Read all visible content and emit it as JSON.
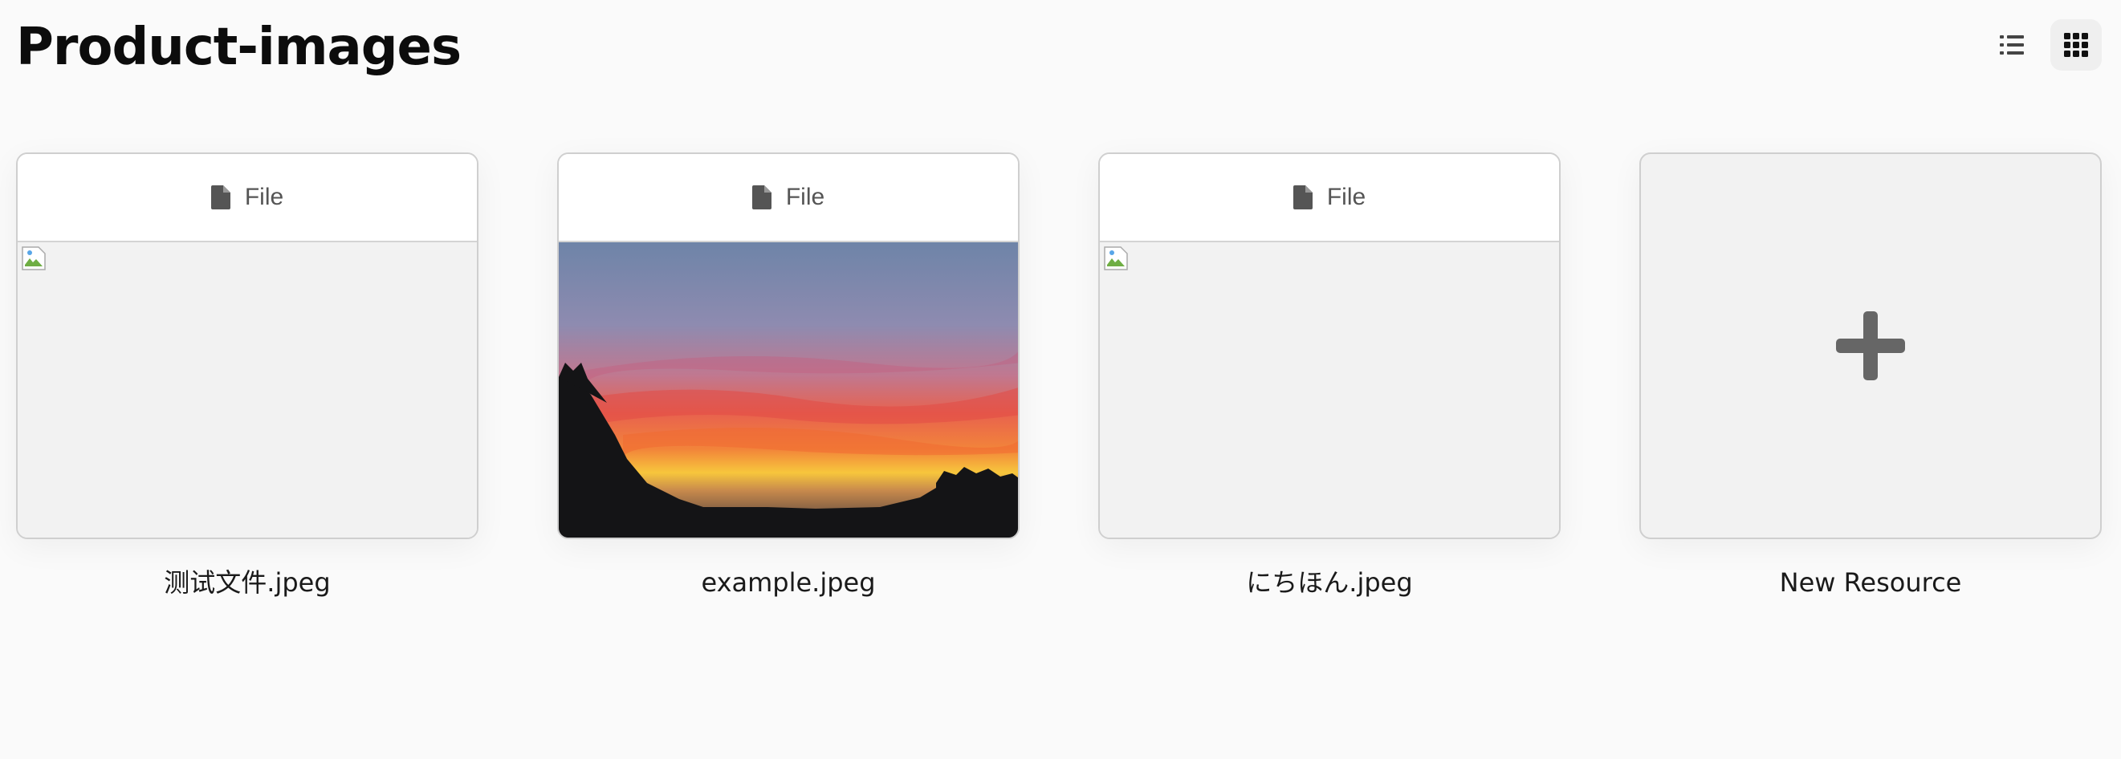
{
  "header": {
    "title": "Product-images"
  },
  "view_toggle": {
    "active": "grid",
    "icons": [
      "list-icon",
      "grid-icon"
    ]
  },
  "tiles": [
    {
      "type_label": "File",
      "name": "测试文件.jpeg",
      "preview": "broken-image"
    },
    {
      "type_label": "File",
      "name": "example.jpeg",
      "preview": "sunset-photo"
    },
    {
      "type_label": "File",
      "name": "にちほん.jpeg",
      "preview": "broken-image"
    }
  ],
  "new_resource": {
    "label": "New Resource"
  },
  "colors": {
    "background": "#fafafa",
    "card_border": "#cfcfcf",
    "preview_bg": "#f2f2f2",
    "icon_gray": "#555555",
    "plus_gray": "#666666"
  }
}
